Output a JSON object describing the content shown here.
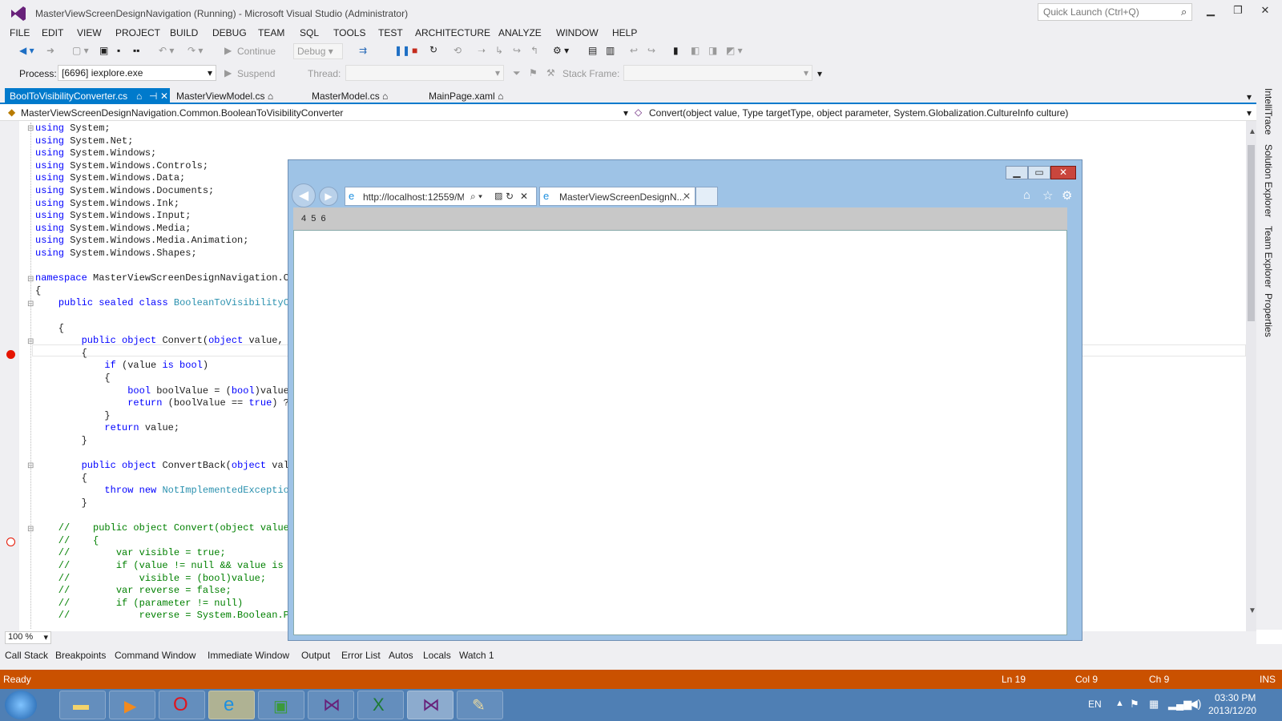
{
  "window": {
    "title": "MasterViewScreenDesignNavigation (Running) - Microsoft Visual Studio (Administrator)",
    "quick_launch_placeholder": "Quick Launch (Ctrl+Q)"
  },
  "menu": [
    "FILE",
    "EDIT",
    "VIEW",
    "PROJECT",
    "BUILD",
    "DEBUG",
    "TEAM",
    "SQL",
    "TOOLS",
    "TEST",
    "ARCHITECTURE",
    "ANALYZE",
    "WINDOW",
    "HELP"
  ],
  "toolbar": {
    "continue_label": "Continue",
    "config": "Debug",
    "process_label": "Process:",
    "process_value": "[6696] iexplore.exe",
    "suspend_label": "Suspend",
    "thread_label": "Thread:",
    "stack_frame_label": "Stack Frame:"
  },
  "tabs": [
    {
      "label": "BoolToVisibilityConverter.cs",
      "active": true
    },
    {
      "label": "MasterViewModel.cs"
    },
    {
      "label": "MasterModel.cs"
    },
    {
      "label": "MainPage.xaml"
    }
  ],
  "navbar": {
    "type": "MasterViewScreenDesignNavigation.Common.BooleanToVisibilityConverter",
    "member": "Convert(object value, Type targetType, object parameter, System.Globalization.CultureInfo culture)"
  },
  "code_lines": [
    "using System;",
    "using System.Net;",
    "using System.Windows;",
    "using System.Windows.Controls;",
    "using System.Windows.Data;",
    "using System.Windows.Documents;",
    "using System.Windows.Ink;",
    "using System.Windows.Input;",
    "using System.Windows.Media;",
    "using System.Windows.Media.Animation;",
    "using System.Windows.Shapes;",
    "",
    "namespace MasterViewScreenDesignNavigation.Co",
    "{",
    "    public sealed class BooleanToVisibilityCo",
    "",
    "    {",
    "        public object Convert(object value, T",
    "        {",
    "            if (value is bool)",
    "            {",
    "                bool boolValue = (bool)value;",
    "                return (boolValue == true) ?",
    "            }",
    "            return value;",
    "        }",
    "",
    "        public object ConvertBack(object valu",
    "        {",
    "            throw new NotImplementedException",
    "        }",
    "",
    "    //    public object Convert(object value,",
    "    //    {",
    "    //        var visible = true;",
    "    //        if (value != null && value is b",
    "    //            visible = (bool)value;",
    "    //        var reverse = false;",
    "    //        if (parameter != null)",
    "    //            reverse = System.Boolean.Pa"
  ],
  "right_tabs": [
    "IntelliTrace",
    "Solution Explorer",
    "Team Explorer",
    "Properties"
  ],
  "zoom": "100 %",
  "bottom_tabs": [
    "Call Stack",
    "Breakpoints",
    "Command Window",
    "Immediate Window",
    "Output",
    "Error List",
    "Autos",
    "Locals",
    "Watch 1"
  ],
  "status": {
    "state": "Ready",
    "ln": "Ln 19",
    "col": "Col 9",
    "ch": "Ch 9",
    "ins": "INS"
  },
  "ie": {
    "address": "http://localhost:12559/M",
    "tab_title": "MasterViewScreenDesignN...",
    "page_text": "4  5  6"
  },
  "taskbar": {
    "lang": "EN",
    "time": "03:30 PM",
    "date": "2013/12/20"
  }
}
